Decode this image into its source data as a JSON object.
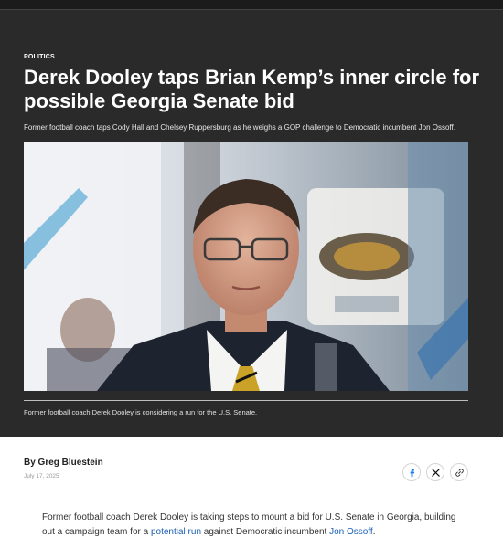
{
  "article": {
    "section": "POLITICS",
    "headline": "Derek Dooley taps Brian Kemp’s inner circle for possible Georgia Senate bid",
    "dek": "Former football coach taps Cody Hall and Chelsey Ruppersburg as he weighs a GOP challenge to Democratic incumbent Jon Ossoff.",
    "photo_caption": "Former football coach Derek Dooley is considering a run for the U.S. Senate.",
    "author": "By Greg Bluestein",
    "date": "July 17, 2025",
    "body_part1": "Former football coach Derek Dooley is taking steps to mount a bid for U.S. Senate in Georgia, building out a campaign team for a ",
    "body_link1": "potential run",
    "body_part2": " against Democratic incumbent ",
    "body_link2": "Jon Ossoff",
    "body_part3": "."
  },
  "share": {
    "icons": [
      "facebook-icon",
      "x-icon",
      "link-icon"
    ]
  },
  "colors": {
    "hero_bg": "#2a2a2a",
    "link": "#1a5fb4",
    "facebook": "#1877f2"
  }
}
